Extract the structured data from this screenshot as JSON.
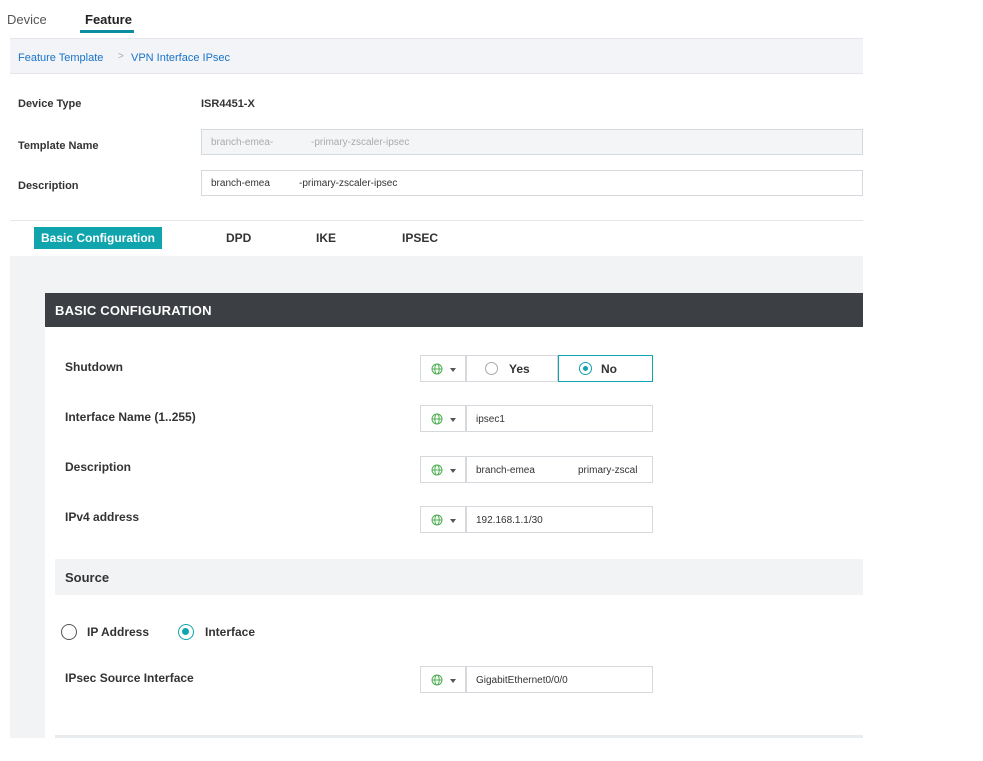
{
  "top_tabs": {
    "device": "Device",
    "feature": "Feature"
  },
  "breadcrumb": {
    "root": "Feature Template",
    "separator": ">",
    "current": "VPN Interface IPsec"
  },
  "header": {
    "device_type_label": "Device Type",
    "device_type_value": "ISR4451-X",
    "template_name_label": "Template Name",
    "template_name_part1": "branch-emea-",
    "template_name_part2": "-primary-zscaler-ipsec",
    "description_label": "Description",
    "description_part1": "branch-emea",
    "description_part2": "-primary-zscaler-ipsec"
  },
  "section_tabs": [
    "Basic Configuration",
    "DPD",
    "IKE",
    "IPSEC"
  ],
  "basic_config": {
    "title": "BASIC CONFIGURATION",
    "shutdown_label": "Shutdown",
    "shutdown_yes": "Yes",
    "shutdown_no": "No",
    "shutdown_selected": "No",
    "interface_name_label": "Interface Name (1..255)",
    "interface_name_value": "ipsec1",
    "description_label": "Description",
    "description_value_part1": "branch-emea",
    "description_value_part2": "primary-zscal",
    "ipv4_label": "IPv4 address",
    "ipv4_value": "192.168.1.1/30"
  },
  "source": {
    "title": "Source",
    "option_ip": "IP Address",
    "option_interface": "Interface",
    "selected": "Interface",
    "ipsec_source_label": "IPsec Source Interface",
    "ipsec_source_value": "GigabitEthernet0/0/0"
  },
  "icons": {
    "scope": "globe-icon",
    "dropdown": "caret-down-icon"
  },
  "colors": {
    "accent": "#10a4ad",
    "link": "#1a73c8",
    "panel_header": "#3c3f43"
  }
}
